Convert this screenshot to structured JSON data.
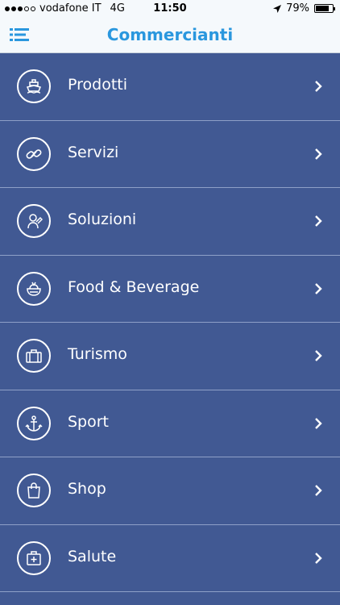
{
  "statusbar": {
    "carrier": "vodafone IT",
    "network": "4G",
    "time": "11:50",
    "battery": "79%",
    "battery_level": 0.79,
    "signal_bars": 3,
    "icons": [
      "location-arrow-icon",
      "battery-icon"
    ]
  },
  "navbar": {
    "title": "Commercianti",
    "menu_icon": "list-menu-icon",
    "title_color": "#2a97de"
  },
  "colors": {
    "background": "#415993",
    "bar": "#f5f9fc"
  },
  "items": [
    {
      "label": "Prodotti",
      "icon": "ship-icon"
    },
    {
      "label": "Servizi",
      "icon": "chain-link-icon"
    },
    {
      "label": "Soluzioni",
      "icon": "worker-icon"
    },
    {
      "label": "Food & Beverage",
      "icon": "food-bowl-icon"
    },
    {
      "label": "Turismo",
      "icon": "suitcase-icon"
    },
    {
      "label": "Sport",
      "icon": "anchor-icon"
    },
    {
      "label": "Shop",
      "icon": "shopping-bag-icon"
    },
    {
      "label": "Salute",
      "icon": "first-aid-kit-icon"
    }
  ]
}
